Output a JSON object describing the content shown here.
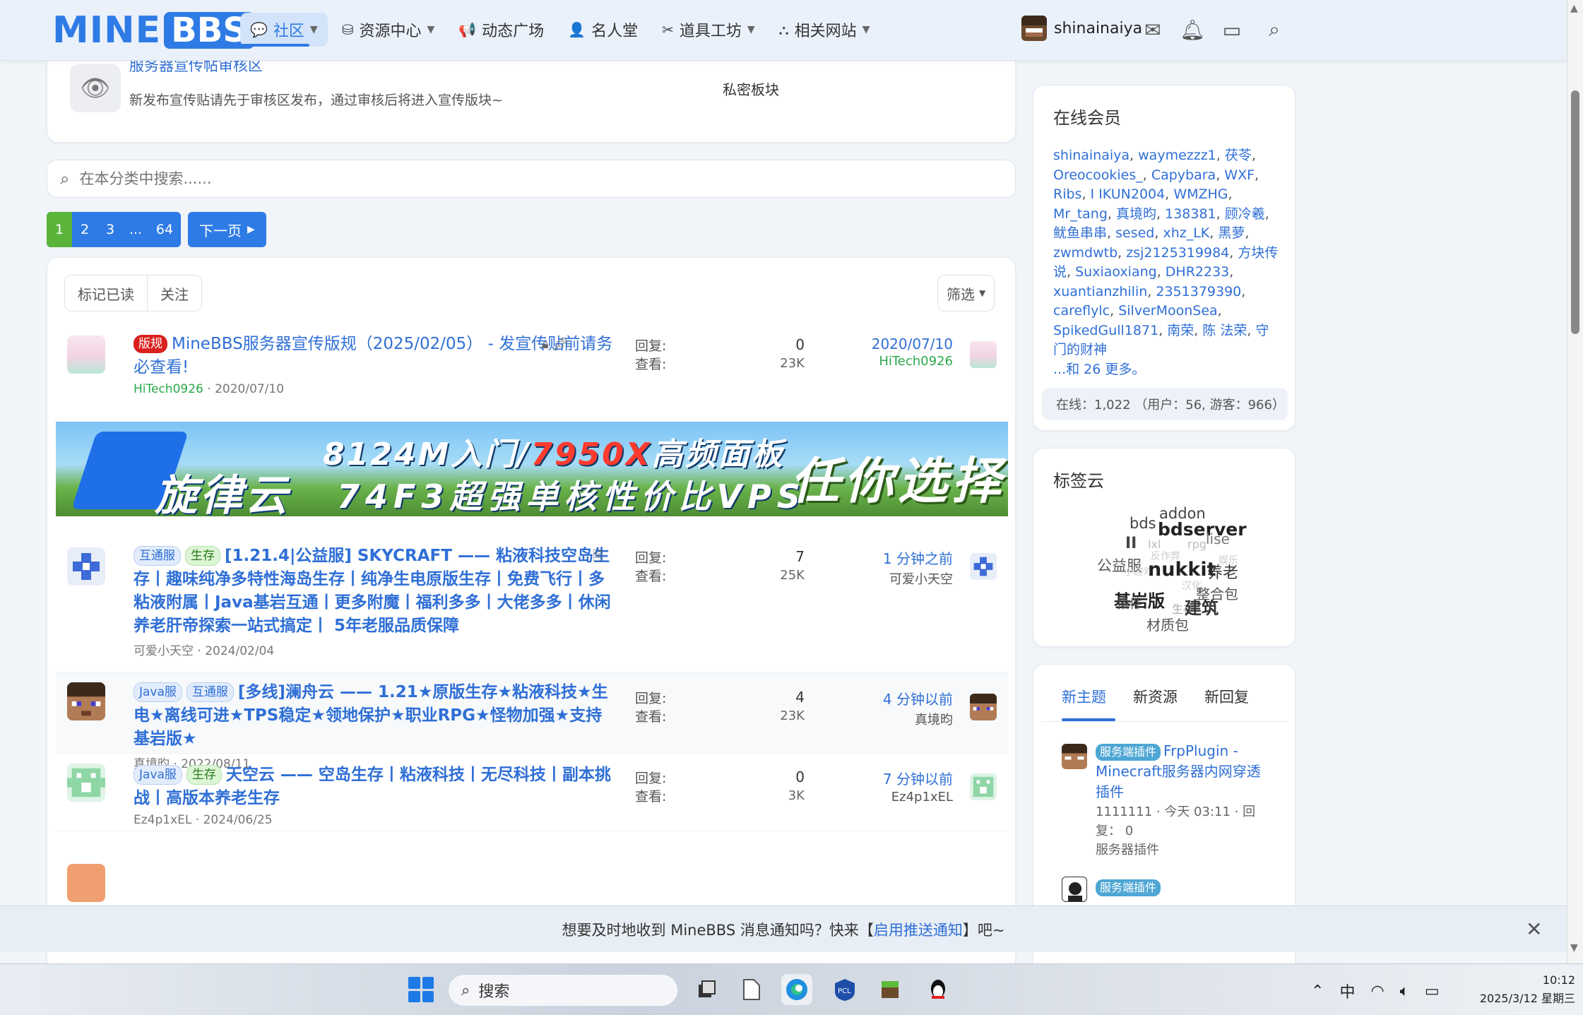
{
  "header": {
    "logo_mine": "MINE",
    "logo_bbs": "BBS",
    "nav": [
      {
        "label": "社区",
        "icon": "chat-icon",
        "dropdown": true,
        "active": true
      },
      {
        "label": "资源中心",
        "icon": "box-icon",
        "dropdown": true
      },
      {
        "label": "动态广场",
        "icon": "megaphone-icon",
        "dropdown": false
      },
      {
        "label": "名人堂",
        "icon": "users-icon",
        "dropdown": false
      },
      {
        "label": "道具工坊",
        "icon": "tools-icon",
        "dropdown": true
      },
      {
        "label": "相关网站",
        "icon": "sitemap-icon",
        "dropdown": true
      }
    ],
    "username": "shinainaiya"
  },
  "review_forum": {
    "title": "服务器宣传帖审核区",
    "desc": "新发布宣传贴请先于审核区发布，通过审核后将进入宣传版块~",
    "label": "私密板块"
  },
  "search": {
    "placeholder": "在本分类中搜索......"
  },
  "pager": {
    "pages": [
      "1",
      "2",
      "3",
      "...",
      "64"
    ],
    "next": "下一页"
  },
  "toolbar": {
    "mark_read": "标记已读",
    "follow": "关注",
    "filter": "筛选"
  },
  "threads": [
    {
      "badges": [
        "版规"
      ],
      "title": "MineBBS服务器宣传版规（2025/02/05） - 发宣传贴前请务必查看!",
      "author": "HiTech0926",
      "date": "2020/07/10",
      "replies_label": "回复:",
      "replies": "0",
      "views_label": "查看:",
      "views": "23K",
      "last_time": "2020/07/10",
      "last_user": "HiTech0926"
    },
    {
      "badges": [
        "互通服",
        "生存"
      ],
      "title": "[1.21.4|公益服] SKYCRAFT —— 粘液科技空岛生存丨趣味纯净多特性海岛生存丨纯净生电原版生存丨免费飞行丨多粘液附属丨Java基岩互通丨更多附魔丨福利多多丨大佬多多丨休闲养老肝帝探索一站式搞定丨 5年老服品质保障",
      "author": "可爱小天空",
      "date": "2024/02/04",
      "replies_label": "回复:",
      "replies": "7",
      "views_label": "查看:",
      "views": "25K",
      "last_time": "1 分钟之前",
      "last_user": "可爱小天空"
    },
    {
      "badges": [
        "Java服",
        "互通服"
      ],
      "title": "[多线]澜舟云 —— 1.21★原版生存★粘液科技★生电★离线可进★TPS稳定★领地保护★职业RPG★怪物加强★支持基岩版★",
      "author": "真境昀",
      "date": "2022/08/11",
      "replies_label": "回复:",
      "replies": "4",
      "views_label": "查看:",
      "views": "23K",
      "last_time": "4 分钟以前",
      "last_user": "真境昀"
    },
    {
      "badges": [
        "Java服",
        "生存"
      ],
      "title": "天空云 —— 空岛生存丨粘液科技丨无尽科技丨副本挑战丨高版本养老生存",
      "author": "Ez4p1xEL",
      "date": "2024/06/25",
      "replies_label": "回复:",
      "replies": "0",
      "views_label": "查看:",
      "views": "3K",
      "last_time": "7 分钟以前",
      "last_user": "Ez4p1xEL"
    }
  ],
  "banner": {
    "brand": "旋律云",
    "line1_a": "8124M入门/",
    "line1_b": "7950X",
    "line1_c": "高频面板",
    "line2": "74F3超强单核性价比VPS",
    "tail": "任你选择"
  },
  "online": {
    "title": "在线会员",
    "members": [
      "shinainaiya",
      "waymezzz1",
      "茯苓",
      "Oreocookies_",
      "Capybara",
      "WXF",
      "Ribs",
      "I IKUN2004",
      "WMZHG",
      "Mr_tang",
      "真境昀",
      "138381",
      "顾冷羲",
      "鱿鱼串串",
      "sesed",
      "xhz_LK",
      "黑萝",
      "zwmdwtb",
      "zsj2125319984",
      "方块传说",
      "Suxiaoxiang",
      "DHR2233",
      "xuantianzhilin",
      "2351379390",
      "careflylc",
      "SilverMoonSea",
      "SpikedGull1871",
      "南荣",
      "陈 法荣",
      "守门的财神"
    ],
    "more": "...和 26 更多。",
    "stats": "在线：1,022 （用户：56, 游客：966）"
  },
  "tags": {
    "title": "标签云",
    "items": [
      "addon",
      "bds",
      "bdserver",
      "II",
      "lxl",
      "rpg",
      "lise",
      "反作弊",
      "公益服",
      "小游戏",
      "nukkit",
      "养老",
      "娱乐",
      "汉化",
      "整合包",
      "基岩版",
      "插件",
      "生存",
      "建筑",
      "材质包"
    ]
  },
  "new_tabs": {
    "tabs": [
      "新主题",
      "新资源",
      "新回复"
    ],
    "items": [
      {
        "badge": "服务端插件",
        "title": "FrpPlugin - Minecraft服务器内网穿透插件",
        "meta": "1111111 · 今天 03:11 · 回复： 0",
        "category": "服务器插件"
      },
      {
        "badge": "服务端插件",
        "title": "",
        "meta": "",
        "category": ""
      }
    ]
  },
  "notify": {
    "prefix": "想要及时地收到 MineBBS 消息通知吗？快来【",
    "link": "启用推送通知",
    "suffix": "】吧~"
  },
  "taskbar": {
    "search": "搜索",
    "ime": "中",
    "time": "10:12",
    "date": "2025/3/12 星期三"
  }
}
